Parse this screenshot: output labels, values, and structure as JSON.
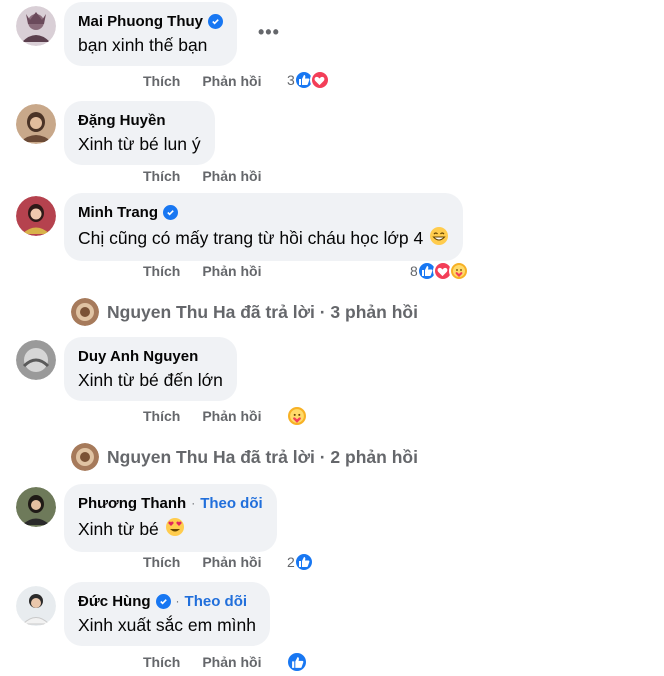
{
  "action_like": "Thích",
  "action_reply": "Phản hồi",
  "follow_label": "Theo dõi",
  "separator": "·",
  "comments": [
    {
      "name": "Mai Phuong Thuy",
      "text": "bạn xinh thế bạn",
      "reaction_count": "3"
    },
    {
      "name": "Đặng Huyền",
      "text": "Xinh từ bé lun ý"
    },
    {
      "name": "Minh Trang",
      "text": "Chị cũng có mấy trang từ hồi cháu học lớp 4",
      "reaction_count": "8"
    },
    {
      "name": "Duy Anh Nguyen",
      "text": "Xinh từ bé đến lớn"
    },
    {
      "name": "Phương Thanh",
      "text": "Xinh từ bé",
      "reaction_count": "2"
    },
    {
      "name": "Đức Hùng",
      "text": "Xinh xuất sắc em mình"
    }
  ],
  "threads": [
    {
      "text": "Nguyen Thu Ha đã trả lời · 3 phản hồi"
    },
    {
      "text": "Nguyen Thu Ha đã trả lời · 2 phản hồi"
    }
  ],
  "colors": {
    "bubble": "#f0f2f5",
    "like": "#1877f2",
    "love": "#f33e58",
    "care": "#f7b125",
    "follow": "#216fdb",
    "muted": "#65676b"
  }
}
